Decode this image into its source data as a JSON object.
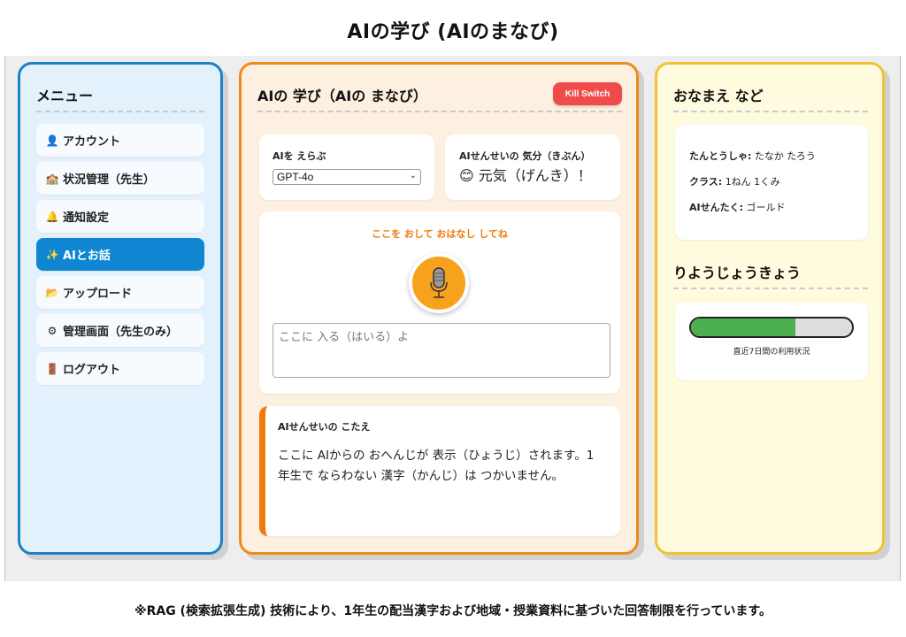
{
  "page": {
    "title": "AIの学び (AIのまなび)",
    "footnote": "※RAG (検索拡張生成) 技術により、1年生の配当漢字および地域・授業資料に基づいた回答制限を行っています。"
  },
  "menu": {
    "heading": "メニュー",
    "items": [
      {
        "icon": "person-icon",
        "glyph": "👤",
        "label": "アカウント",
        "active": false
      },
      {
        "icon": "school-icon",
        "glyph": "🏫",
        "label": "状況管理（先生）",
        "active": false
      },
      {
        "icon": "bell-icon",
        "glyph": "🔔",
        "label": "通知設定",
        "active": false
      },
      {
        "icon": "sparkles-icon",
        "glyph": "✨",
        "label": "AIとお話",
        "active": true
      },
      {
        "icon": "folder-icon",
        "glyph": "📂",
        "label": "アップロード",
        "active": false
      },
      {
        "icon": "gear-icon",
        "glyph": "⚙",
        "label": "管理画面（先生のみ）",
        "active": false
      },
      {
        "icon": "door-icon",
        "glyph": "🚪",
        "label": "ログアウト",
        "active": false
      }
    ]
  },
  "main": {
    "heading": "AIの 学び（AIの まなび）",
    "kill_switch_label": "Kill Switch",
    "model_select": {
      "label": "AIを えらぶ",
      "value": "GPT-4o"
    },
    "mood": {
      "label": "AIせんせいの 気分（きぶん）",
      "value": "元気（げんき）！",
      "icon": "smile-icon",
      "glyph": "😊"
    },
    "talk": {
      "hint": "ここを おして おはなし してね",
      "mic_icon": "microphone-icon",
      "placeholder": "ここに 入る（はいる）よ"
    },
    "answer": {
      "title": "AIせんせいの こたえ",
      "body": "ここに AIからの おへんじが 表示（ひょうじ）されます。1年生で ならわない 漢字（かんじ）は つかいません。"
    }
  },
  "profile": {
    "heading": "おなまえ など",
    "rows": [
      {
        "key": "たんとうしゃ:",
        "value": "たなか たろう"
      },
      {
        "key": "クラス:",
        "value": "1ねん 1くみ"
      },
      {
        "key": "AIせんたく:",
        "value": "ゴールド"
      }
    ]
  },
  "usage": {
    "heading": "りようじょうきょう",
    "fraction": 0.65,
    "caption": "直近7日間の利用状況"
  },
  "colors": {
    "menu_border": "#1a82c8",
    "main_border": "#f08a1a",
    "profile_border": "#f2c232",
    "kill_switch": "#ef4b4b",
    "active_menu": "#0f86d2",
    "usage_fill": "#4caf50"
  }
}
